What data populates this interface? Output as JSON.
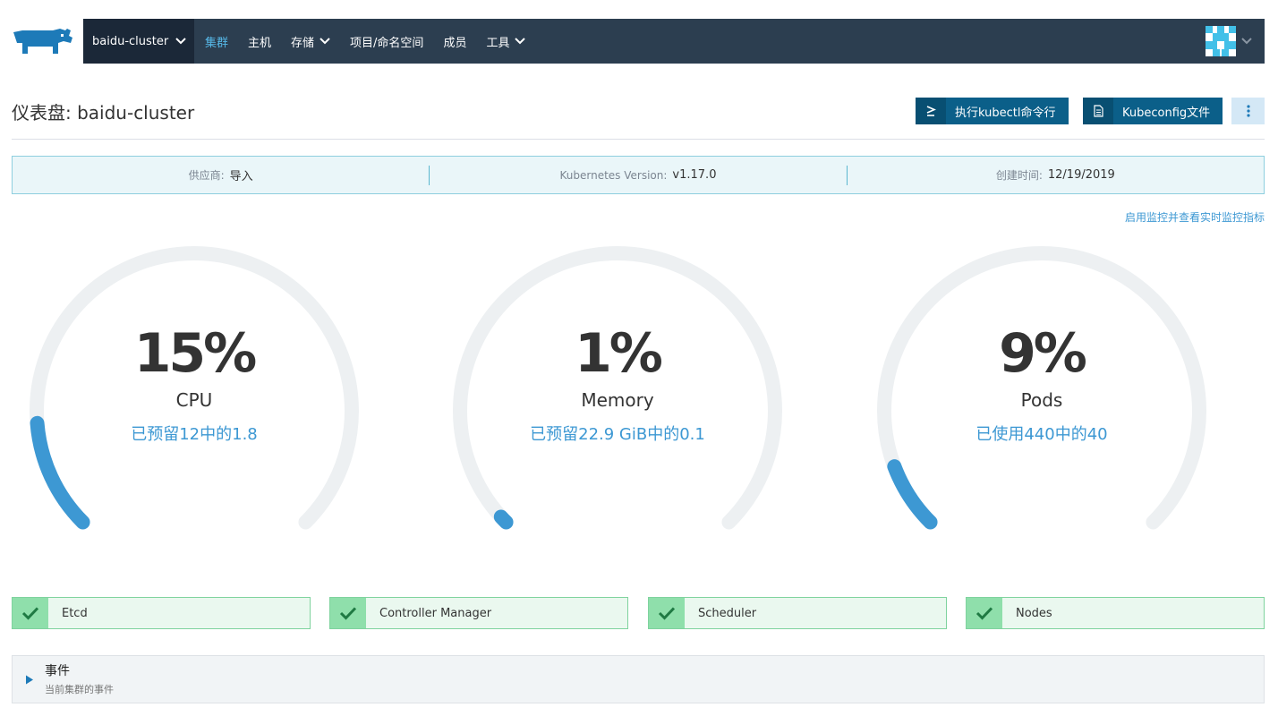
{
  "nav": {
    "cluster": "baidu-cluster",
    "items": [
      {
        "label": "集群",
        "active": true
      },
      {
        "label": "主机"
      },
      {
        "label": "存储",
        "dropdown": true
      },
      {
        "label": "项目/命名空间"
      },
      {
        "label": "成员"
      },
      {
        "label": "工具",
        "dropdown": true
      }
    ]
  },
  "header": {
    "title": "仪表盘: baidu-cluster",
    "kubectl_button": "执行kubectl命令行",
    "kubeconfig_button": "Kubeconfig文件"
  },
  "info": {
    "provider_label": "供应商:",
    "provider_value": "导入",
    "version_label": "Kubernetes Version:",
    "version_value": "v1.17.0",
    "created_label": "创建时间:",
    "created_value": "12/19/2019"
  },
  "monitoring_link": "启用监控并查看实时监控指标",
  "gauges": [
    {
      "percent_text": "15%",
      "percent": 15,
      "name": "CPU",
      "sub": "已预留12中的1.8"
    },
    {
      "percent_text": "1%",
      "percent": 1,
      "name": "Memory",
      "sub": "已预留22.9 GiB中的0.1"
    },
    {
      "percent_text": "9%",
      "percent": 9,
      "name": "Pods",
      "sub": "已使用440中的40"
    }
  ],
  "components": [
    {
      "name": "Etcd",
      "status": "ok"
    },
    {
      "name": "Controller Manager",
      "status": "ok"
    },
    {
      "name": "Scheduler",
      "status": "ok"
    },
    {
      "name": "Nodes",
      "status": "ok"
    }
  ],
  "events": {
    "title": "事件",
    "subtitle": "当前集群的事件"
  },
  "colors": {
    "nav_bg": "#2c3e50",
    "accent_blue": "#3d98d3",
    "gauge_track": "#edf0f2",
    "button_dark": "#0b5f89",
    "success_green": "#8fdfab"
  },
  "icons": {
    "logo": "rancher-logo",
    "kubectl": "terminal-icon",
    "kubeconfig": "file-icon",
    "more": "vertical-ellipsis-icon",
    "component": "check-icon",
    "events": "expand-triangle-icon",
    "avatar": "identicon-avatar"
  }
}
